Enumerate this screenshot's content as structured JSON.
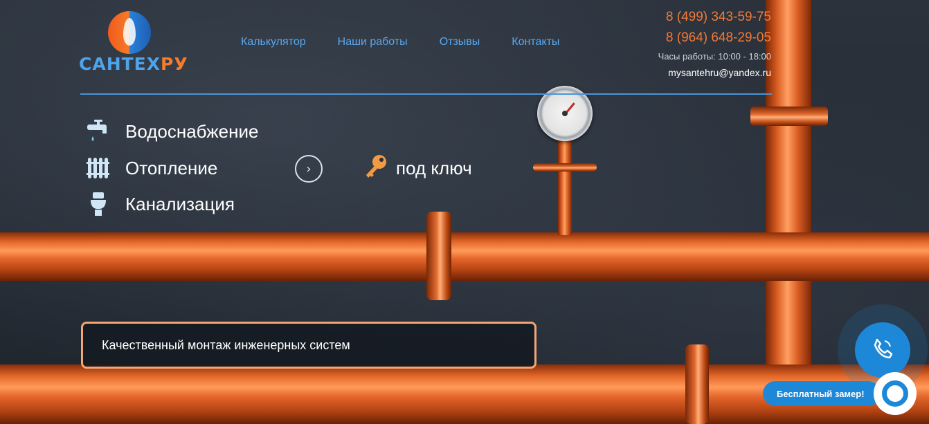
{
  "logo": {
    "text_main": "САНТЕХ",
    "text_accent": "РУ"
  },
  "nav": {
    "items": [
      {
        "label": "Калькулятор"
      },
      {
        "label": "Наши работы"
      },
      {
        "label": "Отзывы"
      },
      {
        "label": "Контакты"
      }
    ]
  },
  "contacts": {
    "phone1": "8 (499) 343-59-75",
    "phone2": "8 (964) 648-29-05",
    "hours": "Часы работы: 10:00 - 18:00",
    "email": "mysantehru@yandex.ru"
  },
  "services": [
    {
      "label": "Водоснабжение",
      "icon": "faucet-icon"
    },
    {
      "label": "Отопление",
      "icon": "radiator-icon"
    },
    {
      "label": "Канализация",
      "icon": "toilet-icon"
    }
  ],
  "turnkey": {
    "label": "под ключ",
    "icon": "key-icon"
  },
  "tagline": "Качественный монтаж инженерных систем",
  "callback": {
    "label": "Бесплатный замер!",
    "icon": "phone-icon"
  },
  "colors": {
    "accent_blue": "#5aa9ee",
    "accent_orange": "#f47a36",
    "widget_blue": "#1e88d8",
    "tagline_border": "#f3a574"
  }
}
